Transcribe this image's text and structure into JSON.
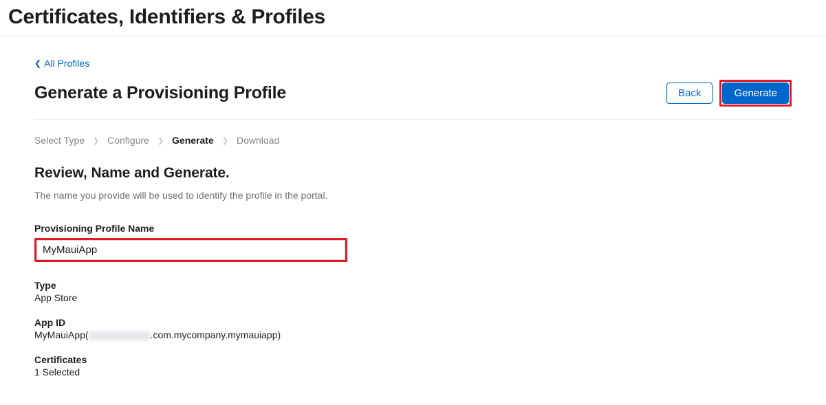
{
  "header": {
    "title": "Certificates, Identifiers & Profiles"
  },
  "nav": {
    "backLink": "All Profiles"
  },
  "page": {
    "title": "Generate a Provisioning Profile",
    "backButton": "Back",
    "generateButton": "Generate"
  },
  "breadcrumb": {
    "steps": [
      "Select Type",
      "Configure",
      "Generate",
      "Download"
    ],
    "activeIndex": 2
  },
  "section": {
    "title": "Review, Name and Generate.",
    "description": "The name you provide will be used to identify the profile in the portal."
  },
  "form": {
    "nameLabel": "Provisioning Profile Name",
    "nameValue": "MyMauiApp"
  },
  "details": {
    "typeLabel": "Type",
    "typeValue": "App Store",
    "appIdLabel": "App ID",
    "appIdPrefix": "MyMauiApp(",
    "appIdSuffix": ".com.mycompany.mymauiapp)",
    "certLabel": "Certificates",
    "certValue": "1 Selected"
  }
}
